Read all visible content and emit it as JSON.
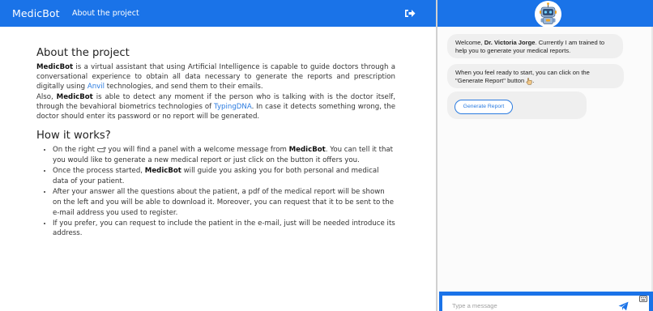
{
  "navbar": {
    "brand": "MedicBot",
    "link_about": "About the project",
    "logout_icon": "sign-out-icon"
  },
  "about": {
    "title": "About the project",
    "p1_b1": "MedicBot",
    "p1_t1": " is a virtual assistant that using Artificial Intelligence is capable to guide doctors through a conversational experience to obtain all data necessary to generate the reports and prescription digitally using ",
    "p1_link": "Anvil",
    "p1_t2": " technologies, and send them to their emails.",
    "p2_t1": "Also, ",
    "p2_b1": "MedicBot",
    "p2_t2": " is able to detect any moment if the person who is talking with is the doctor itself, through the bevahioral biometrics technologies of ",
    "p2_link": "TypingDNA",
    "p2_t3": ". In case it detects something wrong, the doctor should enter its password or no report will be generated."
  },
  "how": {
    "title": "How it works?",
    "li1_t1": "On the right ",
    "li1_t2": " you will find a panel with a welcome message from ",
    "li1_b": "MedicBot",
    "li1_t3": ". You can tell it that you would like to generate a new medical report or just click on the button it offers you.",
    "li2_t1": "Once the process started, ",
    "li2_b": "MedicBot",
    "li2_t2": " will guide you asking you for both personal and medical data of your patient.",
    "li3": "After your answer all the questions about the patient, a pdf of the medical report will be shown on the left and you will be able to download it. Moreover, you can request that it to be sent to the e-mail address you used to register.",
    "li4": "If you prefer, you can request to include the patient in the e-mail, just will be needed introduce its address."
  },
  "chat": {
    "msg1_t1": "Welcome, ",
    "msg1_name": "Dr. Victoria Jorge",
    "msg1_t2": ". Currently I am trained to help you to generate your medical reports.",
    "msg2": "When you feel ready to start, you can click on the \"Generate Report\" button",
    "msg2_end": ".",
    "generate_button": "Generate Report",
    "input_placeholder": "Type a message",
    "send_icon": "paper-plane-icon",
    "keyboard_icon": "keyboard-icon",
    "avatar_icon": "robot-avatar-icon"
  },
  "colors": {
    "primary": "#1a73e8",
    "link": "#2a7be0",
    "bubble": "#efefef"
  }
}
